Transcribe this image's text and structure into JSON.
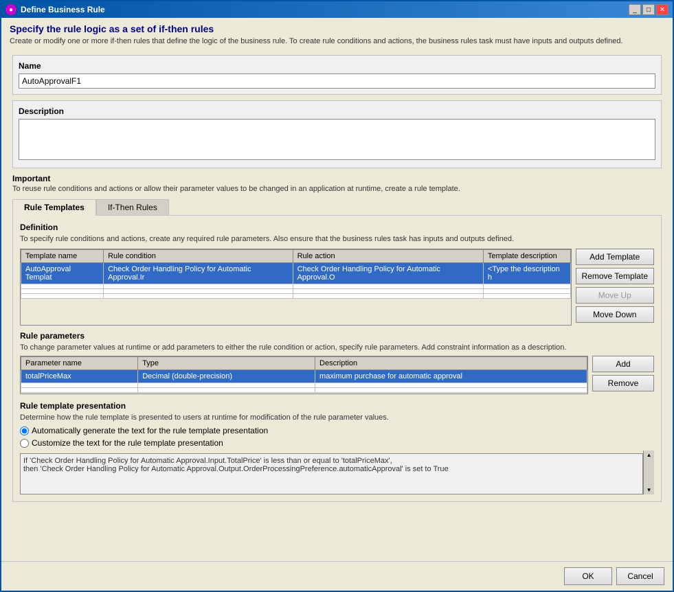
{
  "window": {
    "title": "Define Business Rule",
    "icon": "●"
  },
  "header": {
    "title": "Specify the rule logic as a set of if-then rules",
    "description": "Create or modify one or more if-then rules that define the logic of the business rule. To create rule conditions and actions, the business rules task must have inputs and outputs defined."
  },
  "name_section": {
    "label": "Name",
    "value": "AutoApprovalF1"
  },
  "description_section": {
    "label": "Description",
    "placeholder": ""
  },
  "important_section": {
    "label": "Important",
    "text": "To reuse rule conditions and actions or allow their parameter values to be changed in an application at runtime, create a rule template."
  },
  "tabs": [
    {
      "id": "rule-templates",
      "label": "Rule Templates",
      "active": true
    },
    {
      "id": "if-then-rules",
      "label": "If-Then Rules",
      "active": false
    }
  ],
  "definition": {
    "label": "Definition",
    "description": "To specify rule conditions and actions, create any required rule parameters. Also ensure that the business rules task has inputs and outputs defined."
  },
  "template_table": {
    "columns": [
      "Template name",
      "Rule condition",
      "Rule action",
      "Template description"
    ],
    "rows": [
      {
        "template_name": "AutoApproval Templat",
        "rule_condition": "Check Order Handling Policy for Automatic Approval.Ir",
        "rule_action": "Check Order Handling Policy for Automatic Approval.O",
        "template_description": "<Type the description h"
      }
    ]
  },
  "template_buttons": {
    "add": "Add Template",
    "remove": "Remove Template",
    "move_up": "Move Up",
    "move_down": "Move Down"
  },
  "rule_parameters": {
    "label": "Rule parameters",
    "description": "To change parameter values at runtime or add parameters to either the rule condition or action, specify rule parameters. Add constraint information as a description.",
    "columns": [
      "Parameter name",
      "Type",
      "Description"
    ],
    "rows": [
      {
        "param_name": "totalPriceMax",
        "type": "Decimal (double-precision)",
        "description": "maximum purchase for automatic approval"
      }
    ],
    "add_label": "Add",
    "remove_label": "Remove"
  },
  "presentation": {
    "label": "Rule template presentation",
    "description": "Determine how the rule template is presented to users at runtime for modification of the rule parameter values.",
    "radio_auto": "Automatically generate the text for the rule template presentation",
    "radio_custom": "Customize the text for the rule template presentation",
    "preview_text": "If 'Check Order Handling Policy for Automatic Approval.Input.TotalPrice' is less than or equal to 'totalPriceMax',\nthen 'Check Order Handling Policy for Automatic Approval.Output.OrderProcessingPreference.automaticApproval' is set to True"
  },
  "footer": {
    "ok_label": "OK",
    "cancel_label": "Cancel"
  }
}
